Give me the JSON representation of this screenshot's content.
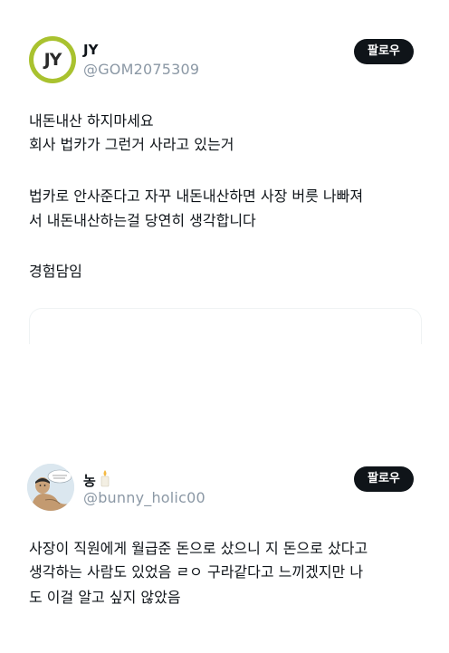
{
  "posts": [
    {
      "display_name": "JY",
      "handle": "@GOM2075309",
      "follow_label": "팔로우",
      "avatar_initials": "JY",
      "text_lines": [
        "내돈내산 하지마세요",
        "회사 법카가 그런거 사라고 있는거",
        "",
        "법카로 안사준다고 자꾸 내돈내산하면 사장 버릇 나빠져",
        "서 내돈내산하는걸 당연히 생각합니다",
        "",
        "경험담임"
      ]
    },
    {
      "display_name": "농",
      "handle": "@bunny_holic00",
      "follow_label": "팔로우",
      "name_emoji": "candle-icon",
      "text_lines": [
        "사장이 직원에게 월급준 돈으로 샀으니 지 돈으로 샀다고",
        "생각하는 사람도 있었음 ㄹㅇ 구라같다고 느끼겠지만 나",
        "도 이걸 알고 싶지 않았음"
      ]
    }
  ],
  "colors": {
    "text": "#0f1419",
    "handle": "#8b98a5",
    "button_bg": "#0f1419",
    "avatar_ring": "#a9c22f"
  }
}
